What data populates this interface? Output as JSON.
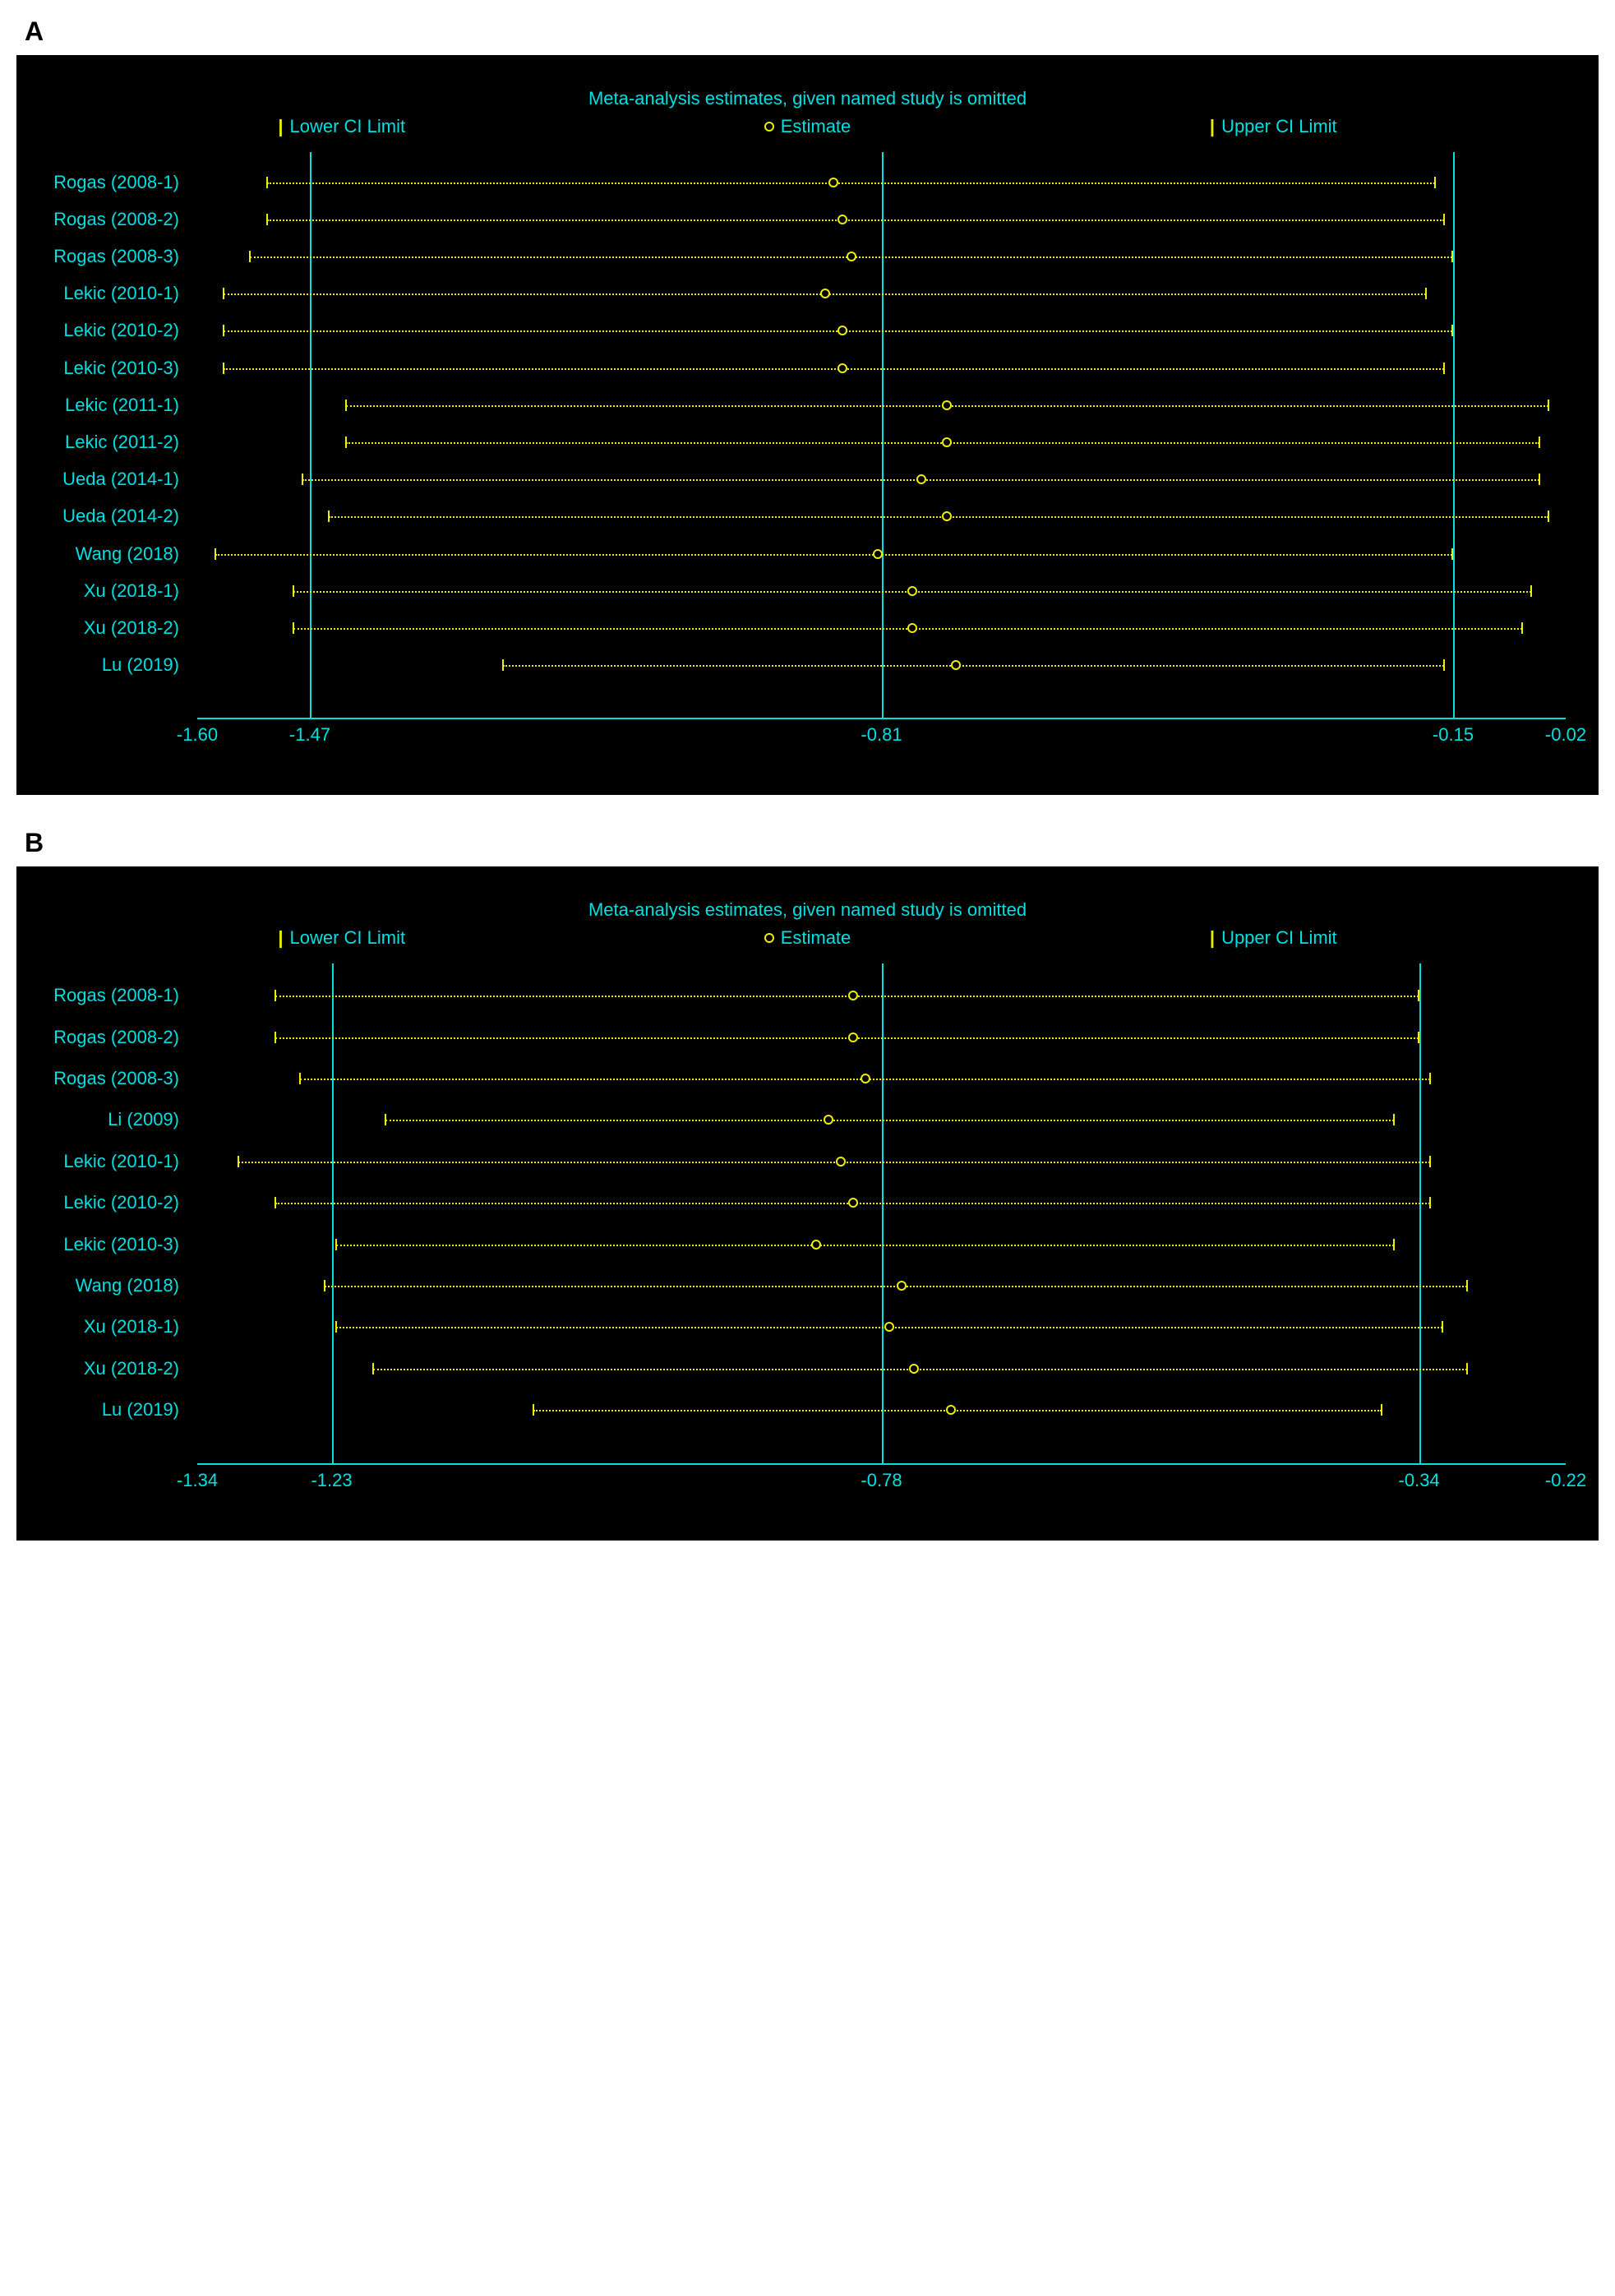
{
  "chart_data": [
    {
      "panel": "A",
      "type": "forest-sensitivity",
      "title": "Meta-analysis estimates, given named study is omitted",
      "legend": {
        "lower": "Lower CI Limit",
        "estimate": "Estimate",
        "upper": "Upper CI Limit"
      },
      "x_axis": {
        "min": -1.6,
        "max": -0.02,
        "ticks": [
          -1.6,
          -1.47,
          -0.81,
          -0.15,
          -0.02
        ]
      },
      "overall": {
        "lower": -1.47,
        "estimate": -0.81,
        "upper": -0.15
      },
      "studies": [
        {
          "name": "Rogas (2008-1)",
          "lower": -1.51,
          "estimate": -0.86,
          "upper": -0.17
        },
        {
          "name": "Rogas (2008-2)",
          "lower": -1.51,
          "estimate": -0.85,
          "upper": -0.16
        },
        {
          "name": "Rogas (2008-3)",
          "lower": -1.53,
          "estimate": -0.84,
          "upper": -0.15
        },
        {
          "name": "Lekic (2010-1)",
          "lower": -1.56,
          "estimate": -0.87,
          "upper": -0.18
        },
        {
          "name": "Lekic (2010-2)",
          "lower": -1.56,
          "estimate": -0.85,
          "upper": -0.15
        },
        {
          "name": "Lekic (2010-3)",
          "lower": -1.56,
          "estimate": -0.85,
          "upper": -0.16
        },
        {
          "name": "Lekic (2011-1)",
          "lower": -1.42,
          "estimate": -0.73,
          "upper": -0.04
        },
        {
          "name": "Lekic (2011-2)",
          "lower": -1.42,
          "estimate": -0.73,
          "upper": -0.05
        },
        {
          "name": "Ueda (2014-1)",
          "lower": -1.47,
          "estimate": -0.76,
          "upper": -0.05
        },
        {
          "name": "Ueda (2014-2)",
          "lower": -1.44,
          "estimate": -0.73,
          "upper": -0.04
        },
        {
          "name": "Wang (2018)",
          "lower": -1.57,
          "estimate": -0.81,
          "upper": -0.15
        },
        {
          "name": "Xu (2018-1)",
          "lower": -1.48,
          "estimate": -0.77,
          "upper": -0.06
        },
        {
          "name": "Xu (2018-2)",
          "lower": -1.48,
          "estimate": -0.77,
          "upper": -0.07
        },
        {
          "name": "Lu (2019)",
          "lower": -1.24,
          "estimate": -0.72,
          "upper": -0.16
        }
      ]
    },
    {
      "panel": "B",
      "type": "forest-sensitivity",
      "title": "Meta-analysis estimates, given named study is omitted",
      "legend": {
        "lower": "Lower CI Limit",
        "estimate": "Estimate",
        "upper": "Upper CI Limit"
      },
      "x_axis": {
        "min": -1.34,
        "max": -0.22,
        "ticks": [
          -1.34,
          -1.23,
          -0.78,
          -0.34,
          -0.22
        ]
      },
      "overall": {
        "lower": -1.23,
        "estimate": -0.78,
        "upper": -0.34
      },
      "studies": [
        {
          "name": "Rogas (2008-1)",
          "lower": -1.27,
          "estimate": -0.8,
          "upper": -0.34
        },
        {
          "name": "Rogas (2008-2)",
          "lower": -1.27,
          "estimate": -0.8,
          "upper": -0.34
        },
        {
          "name": "Rogas (2008-3)",
          "lower": -1.25,
          "estimate": -0.79,
          "upper": -0.33
        },
        {
          "name": "Li (2009)",
          "lower": -1.18,
          "estimate": -0.82,
          "upper": -0.36
        },
        {
          "name": "Lekic (2010-1)",
          "lower": -1.3,
          "estimate": -0.81,
          "upper": -0.33
        },
        {
          "name": "Lekic (2010-2)",
          "lower": -1.27,
          "estimate": -0.8,
          "upper": -0.33
        },
        {
          "name": "Lekic (2010-3)",
          "lower": -1.22,
          "estimate": -0.83,
          "upper": -0.36
        },
        {
          "name": "Wang (2018)",
          "lower": -1.23,
          "estimate": -0.76,
          "upper": -0.3
        },
        {
          "name": "Xu (2018-1)",
          "lower": -1.22,
          "estimate": -0.77,
          "upper": -0.32
        },
        {
          "name": "Xu (2018-2)",
          "lower": -1.19,
          "estimate": -0.75,
          "upper": -0.3
        },
        {
          "name": "Lu (2019)",
          "lower": -1.06,
          "estimate": -0.72,
          "upper": -0.37
        }
      ]
    }
  ]
}
